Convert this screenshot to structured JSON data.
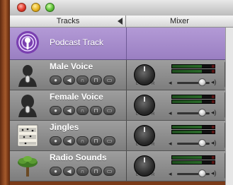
{
  "window": {
    "title": ""
  },
  "header": {
    "tracks_label": "Tracks",
    "mixer_label": "Mixer"
  },
  "tracks": [
    {
      "name": "Podcast Track",
      "icon": "podcast-icon"
    },
    {
      "name": "Male Voice",
      "icon": "male-voice-icon",
      "volume": 0.75,
      "meter_top": 0.7,
      "meter_bottom": 0.7
    },
    {
      "name": "Female Voice",
      "icon": "female-voice-icon",
      "volume": 0.75,
      "meter_top": 0.7,
      "meter_bottom": 0.7
    },
    {
      "name": "Jingles",
      "icon": "sheet-music-icon",
      "volume": 0.75,
      "meter_top": 0.7,
      "meter_bottom": 0.7
    },
    {
      "name": "Radio Sounds",
      "icon": "tree-icon",
      "volume": 0.75,
      "meter_top": 0.7,
      "meter_bottom": 0.7
    }
  ],
  "control_glyphs": {
    "record": "●",
    "mute": "◀",
    "solo": "∩",
    "lock": "⊓",
    "view": "▭"
  },
  "colors": {
    "podcast_row": "#a98bd0",
    "track_row": "#8e8e8e",
    "arrow_up": "#f0a020",
    "arrow_down": "#3a86e0"
  }
}
